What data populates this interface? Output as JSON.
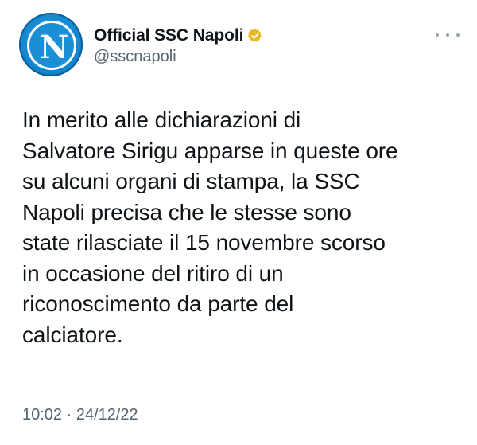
{
  "account": {
    "display_name": "Official SSC Napoli",
    "handle": "@sscnapoli",
    "avatar_letter": "N",
    "verified_icon": "verified-gold-badge-icon",
    "verified_color": "#e8b923",
    "more_icon": "more-horizontal-icon"
  },
  "tweet": {
    "lines": [
      "In merito alle dichiarazioni di",
      "Salvatore Sirigu apparse in queste ore",
      "su alcuni organi di stampa, la SSC",
      "Napoli precisa che le stesse sono",
      "state rilasciate il 15 novembre scorso",
      "in occasione del ritiro di un",
      "riconoscimento da parte del",
      "calciatore."
    ],
    "timestamp": "10:02 · 24/12/22"
  },
  "colors": {
    "text_primary": "#0f1419",
    "text_secondary": "#536471",
    "avatar_blue": "#1487cf"
  }
}
